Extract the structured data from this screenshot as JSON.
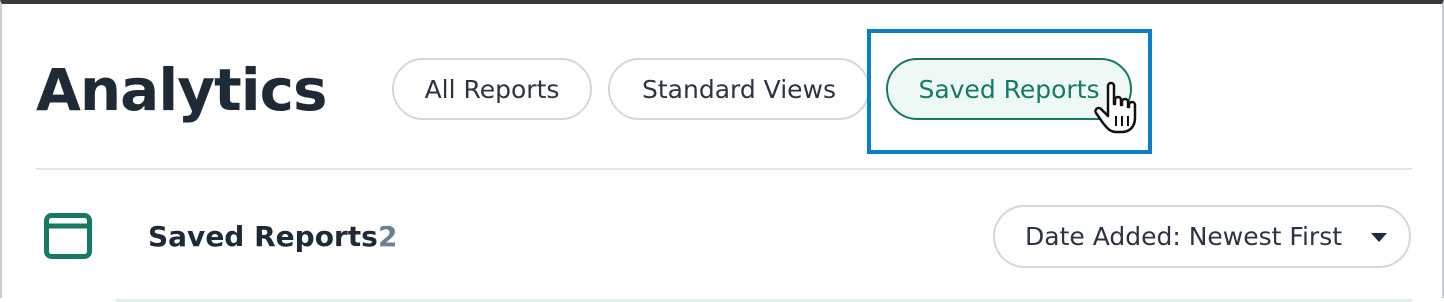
{
  "header": {
    "title": "Analytics"
  },
  "tabs": [
    {
      "label": "All Reports",
      "active": false
    },
    {
      "label": "Standard Views",
      "active": false
    },
    {
      "label": "Saved Reports",
      "active": true
    }
  ],
  "section": {
    "icon": "window-icon",
    "title": "Saved Reports",
    "count": "2"
  },
  "sort": {
    "label": "Date Added: Newest First",
    "icon": "caret-down-icon"
  },
  "colors": {
    "accent": "#167a63",
    "accent_bg": "#eef9f5",
    "highlight": "#0a7fc7",
    "text": "#1f2a37",
    "muted": "#6f7f8f"
  }
}
